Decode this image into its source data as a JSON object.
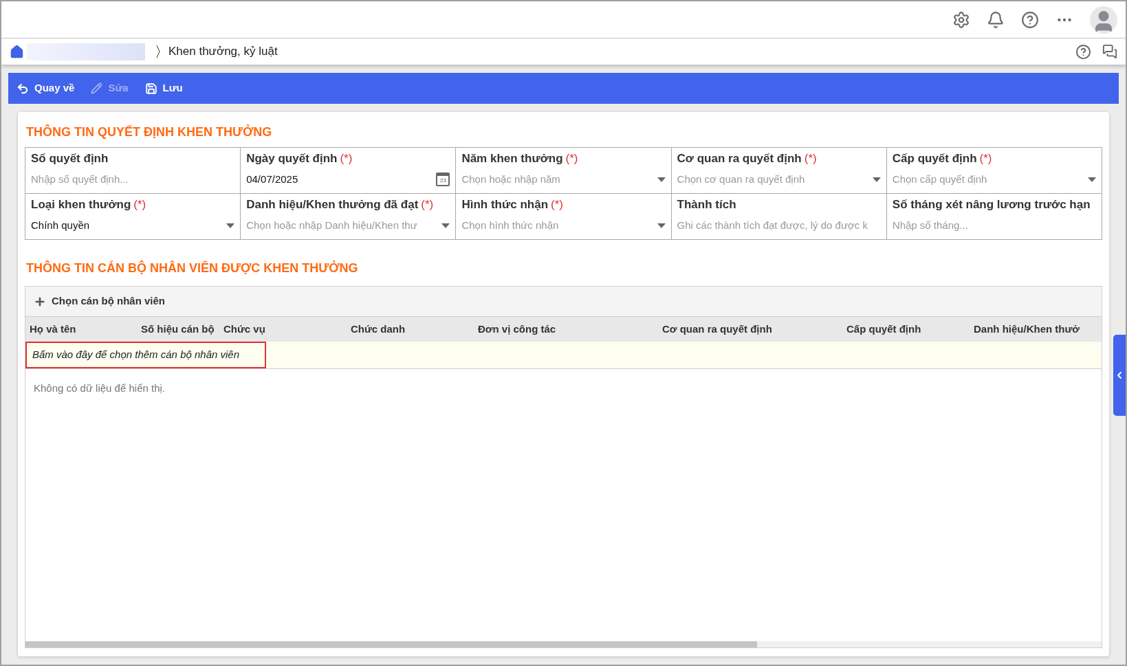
{
  "breadcrumb": {
    "current": "Khen thưởng, kỷ luật"
  },
  "toolbar": [
    {
      "label": "Quay về",
      "kind": "back",
      "disabled": false
    },
    {
      "label": "Sửa",
      "kind": "edit",
      "disabled": true
    },
    {
      "label": "Lưu",
      "kind": "save",
      "disabled": false
    }
  ],
  "decision_section": {
    "title": "THÔNG TIN QUYẾT ĐỊNH KHEN THƯỞNG",
    "required_mark": "(*)",
    "fields": [
      {
        "label": "Số quyết định",
        "required": false,
        "kind": "text",
        "placeholder": "Nhập số quyết định..."
      },
      {
        "label": "Ngày quyết định",
        "required": true,
        "kind": "date",
        "value": "04/07/2025",
        "calendar_day": "23"
      },
      {
        "label": "Năm khen thưởng",
        "required": true,
        "kind": "select",
        "placeholder": "Chọn hoặc nhập năm"
      },
      {
        "label": "Cơ quan ra quyết định",
        "required": true,
        "kind": "select",
        "placeholder": "Chọn cơ quan ra quyết định"
      },
      {
        "label": "Cấp quyết định",
        "required": true,
        "kind": "select",
        "placeholder": "Chọn cấp quyết định"
      },
      {
        "label": "Loại khen thưởng",
        "required": true,
        "kind": "select",
        "value": "Chính quyền"
      },
      {
        "label": "Danh hiệu/Khen thưởng đã đạt",
        "required": true,
        "kind": "select",
        "placeholder": "Chọn hoặc nhập Danh hiệu/Khen thư"
      },
      {
        "label": "Hình thức nhận",
        "required": true,
        "kind": "select",
        "placeholder": "Chọn hình thức nhận"
      },
      {
        "label": "Thành tích",
        "required": false,
        "kind": "text",
        "placeholder": "Ghi các thành tích đạt được, lý do được k"
      },
      {
        "label": "Số tháng xét nâng lương trước hạn",
        "required": false,
        "kind": "text",
        "placeholder": "Nhập số tháng..."
      }
    ]
  },
  "staff_section": {
    "title": "THÔNG TIN CÁN BỘ NHÂN VIÊN ĐƯỢC KHEN THƯỞNG",
    "add_button": "Chọn cán bộ nhân viên",
    "table": {
      "columns": [
        "Họ và tên",
        "Số hiệu cán bộ",
        "Chức vụ",
        "Chức danh",
        "Đơn vị công tác",
        "Cơ quan ra quyết định",
        "Cấp quyết định",
        "Danh hiệu/Khen thưở"
      ],
      "add_row": "Bấm vào đây để chọn thêm cán bộ nhân viên",
      "empty_text": "Không có dữ liệu để hiển thị."
    }
  }
}
